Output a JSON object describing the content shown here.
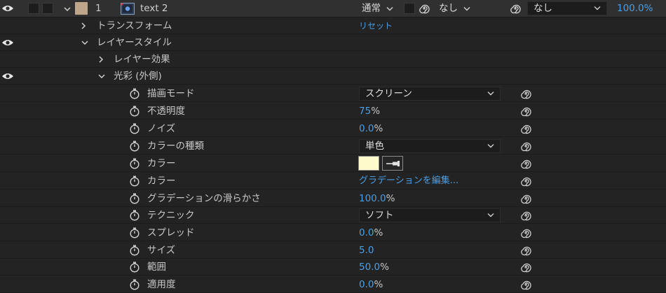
{
  "layer": {
    "number": "1",
    "name": "text 2",
    "blend_mode": "通常",
    "track_matte": "なし",
    "parent": "なし",
    "opacity": "100.0%",
    "label_color": "#bda68c"
  },
  "transform": {
    "label": "トランスフォーム",
    "reset": "リセット"
  },
  "layer_styles": {
    "label": "レイヤースタイル"
  },
  "layer_effects": {
    "label": "レイヤー効果"
  },
  "outer_glow": {
    "label": "光彩 (外側)"
  },
  "properties": {
    "blend_mode": {
      "label": "描画モード",
      "value": "スクリーン"
    },
    "opacity": {
      "label": "不透明度",
      "value": "75",
      "unit": "%"
    },
    "noise": {
      "label": "ノイズ",
      "value": "0.0",
      "unit": "%"
    },
    "color_type": {
      "label": "カラーの種類",
      "value": "単色"
    },
    "color": {
      "label": "カラー",
      "swatch": "#fffacc"
    },
    "gradient": {
      "label": "カラー",
      "value": "グラデーションを編集..."
    },
    "gradient_smoothness": {
      "label": "グラデーションの滑らかさ",
      "value": "100.0",
      "unit": "%"
    },
    "technique": {
      "label": "テクニック",
      "value": "ソフト"
    },
    "spread": {
      "label": "スプレッド",
      "value": "0.0",
      "unit": "%"
    },
    "size": {
      "label": "サイズ",
      "value": "5.0"
    },
    "range": {
      "label": "範囲",
      "value": "50.0",
      "unit": "%"
    },
    "jitter": {
      "label": "適用度",
      "value": "0.0",
      "unit": "%"
    }
  },
  "colors": {
    "accent_blue": "#4a9fe6",
    "background": "#232323"
  }
}
